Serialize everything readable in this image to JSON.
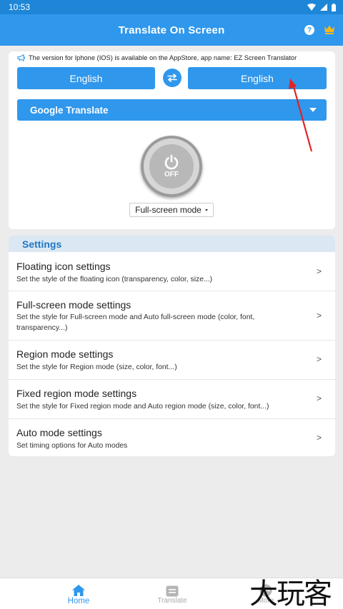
{
  "status_bar": {
    "time": "10:53"
  },
  "app_bar": {
    "title": "Translate On Screen",
    "help_label": "?"
  },
  "notice": {
    "text": "The version for Iphone (IOS) is available on the AppStore, app name: EZ Screen Translator"
  },
  "languages": {
    "source": "English",
    "target": "English"
  },
  "engine": {
    "selected": "Google Translate"
  },
  "power": {
    "state_label": "OFF"
  },
  "mode": {
    "selected": "Full-screen mode"
  },
  "settings": {
    "header": "Settings",
    "items": [
      {
        "title": "Floating icon settings",
        "desc": "Set the style of the floating icon (transparency, color, size...)",
        "chevron": ">"
      },
      {
        "title": "Full-screen mode settings",
        "desc": "Set the style for Full-screen mode and Auto full-screen mode (color, font, transparency...)",
        "chevron": ">"
      },
      {
        "title": "Region mode settings",
        "desc": "Set the style for Region mode (size, color, font...)",
        "chevron": ">"
      },
      {
        "title": "Fixed region mode settings",
        "desc": "Set the style for Fixed region mode and Auto region mode (size, color, font...)",
        "chevron": ">"
      },
      {
        "title": "Auto mode settings",
        "desc": "Set timing options for Auto modes",
        "chevron": ">"
      }
    ]
  },
  "bottom_nav": {
    "items": [
      {
        "label": "Home",
        "icon": "home-icon",
        "active": true
      },
      {
        "label": "Translate",
        "icon": "translate-icon",
        "active": false
      },
      {
        "label": "More",
        "icon": "more-icon",
        "active": false
      }
    ]
  },
  "watermark": {
    "text": "大玩客"
  },
  "colors": {
    "primary": "#2f97ec",
    "status_bar": "#1e86d6",
    "settings_header_bg": "#dbe8f4",
    "settings_header_text": "#2276c2",
    "annotation_arrow": "#e02424"
  }
}
